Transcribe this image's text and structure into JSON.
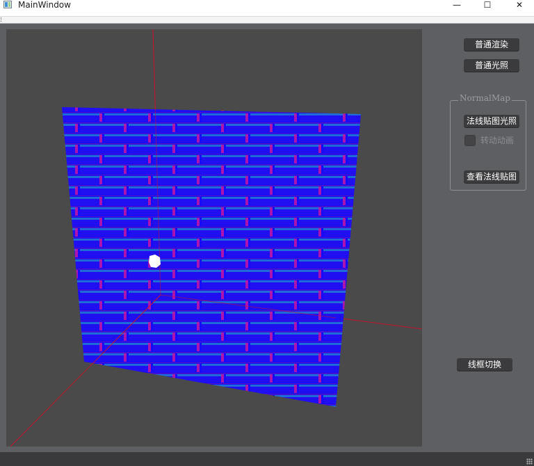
{
  "window": {
    "title": "MainWindow",
    "minimize_glyph": "—",
    "maximize_glyph": "☐",
    "close_glyph": "✕"
  },
  "render_buttons": {
    "normal_render": "普通渲染",
    "normal_lighting": "普通光照"
  },
  "normal_map_group": {
    "title": "NormalMap",
    "normal_map_lighting": "法线贴图光照",
    "rotate_animation_label": "转动动画",
    "rotate_animation_checked": false,
    "view_normal_map": "查看法线贴图"
  },
  "wireframe_toggle": "线框切换",
  "colors": {
    "viewport_bg": "#4a4a4a",
    "panel_bg": "#5d5f62",
    "button_bg": "#3b3b3d",
    "axis_line": "#c4162e",
    "normal_map_blue": "#1a0cff",
    "light_marker": "#ffffff"
  },
  "icons": {
    "app": "window-app-icon",
    "minimize": "minimize-icon",
    "maximize": "maximize-icon",
    "close": "close-icon"
  }
}
